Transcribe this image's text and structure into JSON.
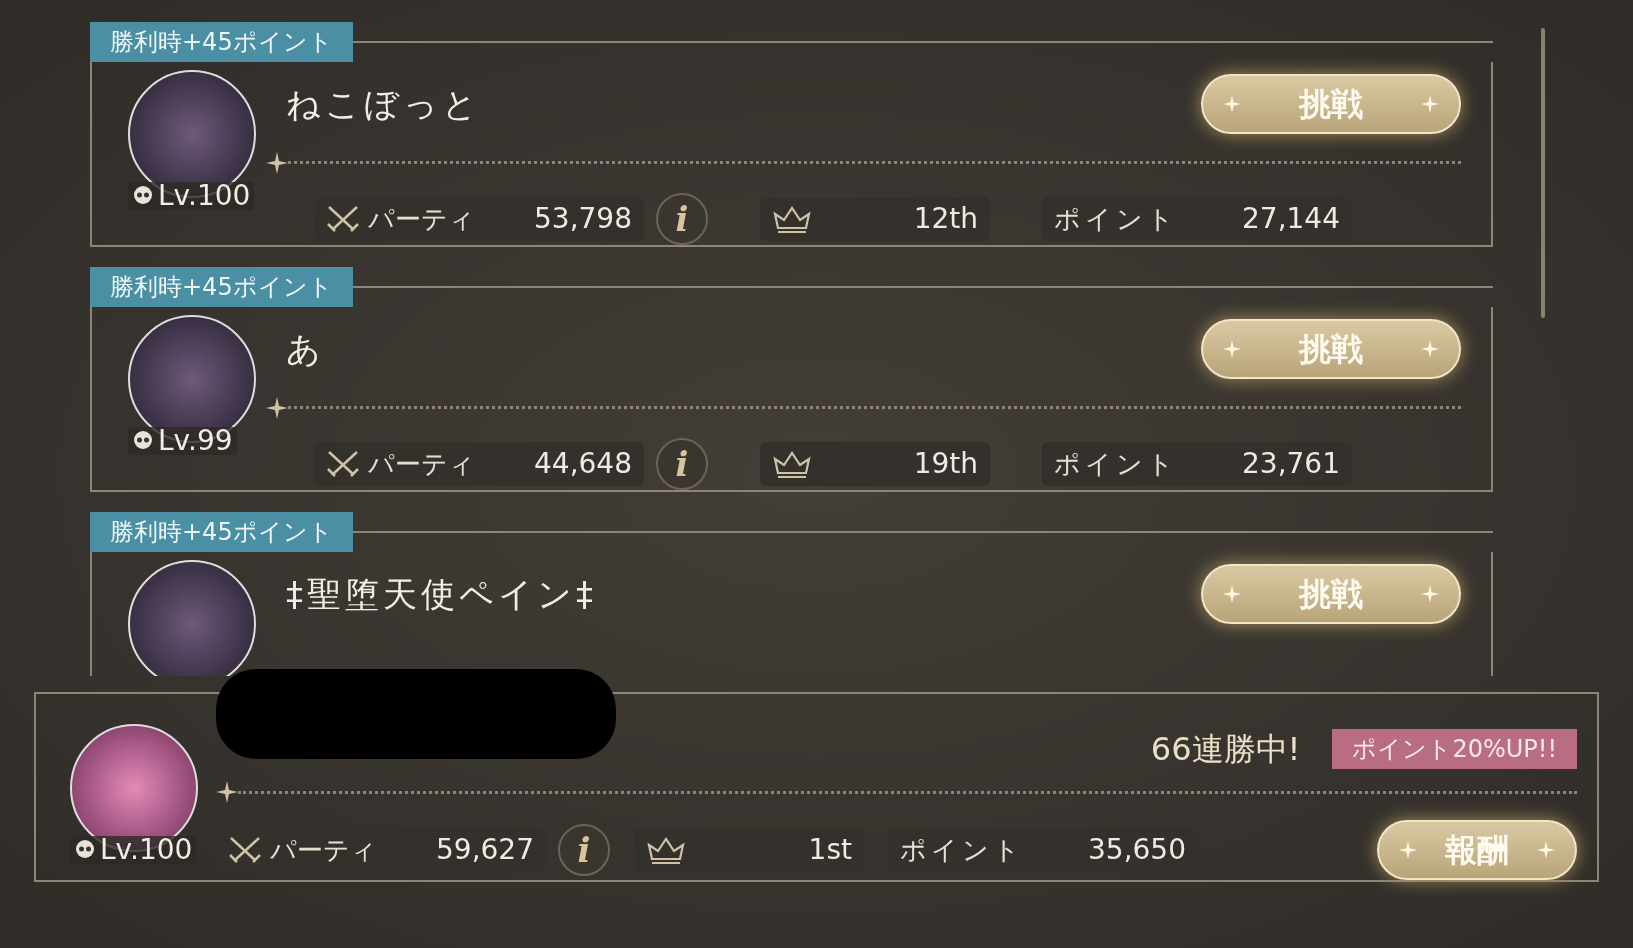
{
  "opponents": [
    {
      "bonus": "勝利時+45ポイント",
      "name": "ねこぼっと",
      "level": "Lv.100",
      "button": "挑戦",
      "stats": {
        "party_label": "パーティ",
        "party": "53,798",
        "info": "i",
        "rank": "12th",
        "points_label": "ポイント",
        "points": "27,144"
      }
    },
    {
      "bonus": "勝利時+45ポイント",
      "name": "あ",
      "level": "Lv.99",
      "button": "挑戦",
      "stats": {
        "party_label": "パーティ",
        "party": "44,648",
        "info": "i",
        "rank": "19th",
        "points_label": "ポイント",
        "points": "23,761"
      }
    },
    {
      "bonus": "勝利時+45ポイント",
      "name": "‡聖堕天使ペイン‡",
      "button": "挑戦"
    }
  ],
  "player": {
    "level": "Lv.100",
    "streak": "66連勝中!",
    "bonus_badge": "ポイント20%UP!!",
    "button": "報酬",
    "stats": {
      "party_label": "パーティ",
      "party": "59,627",
      "info": "i",
      "rank": "1st",
      "points_label": "ポイント",
      "points": "35,650"
    }
  }
}
